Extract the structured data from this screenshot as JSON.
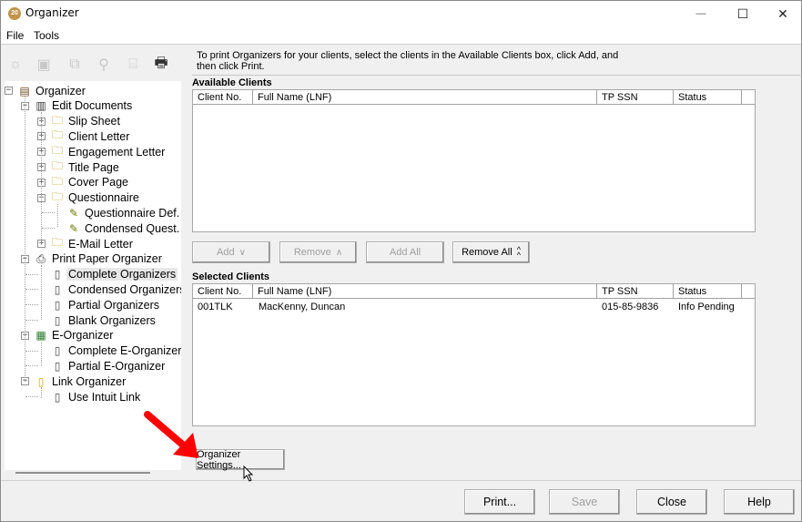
{
  "window": {
    "title": "Organizer",
    "app_icon_text": "20",
    "controls": {
      "minimize": "—",
      "maximize": "☐",
      "close": "✕"
    }
  },
  "menu": [
    {
      "label": "File"
    },
    {
      "label": "Tools"
    }
  ],
  "toolbar": [
    {
      "icon": "sun-icon",
      "glyph": "☼",
      "enabled": false
    },
    {
      "icon": "document-icon",
      "glyph": "▣",
      "enabled": false
    },
    {
      "icon": "copy-icon",
      "glyph": "⧉",
      "enabled": false
    },
    {
      "icon": "search-icon",
      "glyph": "⚲",
      "enabled": false
    },
    {
      "icon": "save-icon",
      "glyph": "⌸",
      "enabled": false
    },
    {
      "icon": "printer-icon",
      "glyph": "🖶",
      "enabled": true
    }
  ],
  "instructions": "To print Organizers for your clients, select the clients in the Available Clients box, click Add, and then click Print.",
  "tree": {
    "nodes": [
      {
        "label": "Organizer",
        "level": 0,
        "expander": "−",
        "icon": "organizer-icon"
      },
      {
        "label": "Edit Documents",
        "level": 1,
        "expander": "−",
        "icon": "documents-icon"
      },
      {
        "label": "Slip Sheet",
        "level": 2,
        "expander": "+",
        "icon": "folder-doc-icon"
      },
      {
        "label": "Client Letter",
        "level": 2,
        "expander": "+",
        "icon": "folder-doc-icon"
      },
      {
        "label": "Engagement Letter",
        "level": 2,
        "expander": "+",
        "icon": "folder-doc-icon"
      },
      {
        "label": "Title Page",
        "level": 2,
        "expander": "+",
        "icon": "folder-doc-icon"
      },
      {
        "label": "Cover Page",
        "level": 2,
        "expander": "+",
        "icon": "folder-doc-icon"
      },
      {
        "label": "Questionnaire",
        "level": 2,
        "expander": "−",
        "icon": "folder-doc-icon"
      },
      {
        "label": "Questionnaire Def.",
        "level": 3,
        "expander": "",
        "icon": "questionnaire-icon"
      },
      {
        "label": "Condensed Quest.",
        "level": 3,
        "expander": "",
        "icon": "questionnaire-icon"
      },
      {
        "label": "E-Mail Letter",
        "level": 2,
        "expander": "+",
        "icon": "folder-doc-icon"
      },
      {
        "label": "Print Paper Organizer",
        "level": 1,
        "expander": "−",
        "icon": "printer-icon"
      },
      {
        "label": "Complete Organizers",
        "level": 2,
        "expander": "",
        "icon": "page-icon",
        "selected": true
      },
      {
        "label": "Condensed Organizers",
        "level": 2,
        "expander": "",
        "icon": "page-icon"
      },
      {
        "label": "Partial Organizers",
        "level": 2,
        "expander": "",
        "icon": "page-icon"
      },
      {
        "label": "Blank Organizers",
        "level": 2,
        "expander": "",
        "icon": "page-icon"
      },
      {
        "label": "E-Organizer",
        "level": 1,
        "expander": "−",
        "icon": "e-organizer-icon"
      },
      {
        "label": "Complete E-Organizer",
        "level": 2,
        "expander": "",
        "icon": "page-icon"
      },
      {
        "label": "Partial E-Organizer",
        "level": 2,
        "expander": "",
        "icon": "page-icon"
      },
      {
        "label": "Link Organizer",
        "level": 1,
        "expander": "−",
        "icon": "link-doc-icon"
      },
      {
        "label": "Use Intuit Link",
        "level": 2,
        "expander": "",
        "icon": "page-icon"
      }
    ]
  },
  "available_clients": {
    "label": "Available Clients",
    "columns": [
      "Client No.",
      "Full Name (LNF)",
      "TP SSN",
      "Status"
    ],
    "rows": []
  },
  "transfer_buttons": [
    {
      "label": "Add",
      "mnemonic_index": 0,
      "chevron": "∨",
      "enabled": false
    },
    {
      "label": "Remove",
      "mnemonic_index": 0,
      "chevron": "∧",
      "enabled": false
    },
    {
      "label": "Add All",
      "mnemonic_index": 1,
      "chevron": "",
      "enabled": false
    },
    {
      "label": "Remove All",
      "mnemonic_index": 1,
      "chevron": "⌃⌃",
      "enabled": true
    }
  ],
  "selected_clients": {
    "label": "Selected Clients",
    "columns": [
      "Client No.",
      "Full Name (LNF)",
      "TP SSN",
      "Status"
    ],
    "rows": [
      [
        "001TLK",
        "MacKenny, Duncan",
        "015-85-9836",
        "Info Pending"
      ]
    ]
  },
  "organizer_settings_button": "Organizer Settings...",
  "footer_buttons": [
    {
      "label": "Print...",
      "enabled": true
    },
    {
      "label": "Save",
      "enabled": false
    },
    {
      "label": "Close",
      "enabled": true
    },
    {
      "label": "Help",
      "enabled": true
    }
  ],
  "annotation": {
    "arrow_color": "#ff0000"
  }
}
